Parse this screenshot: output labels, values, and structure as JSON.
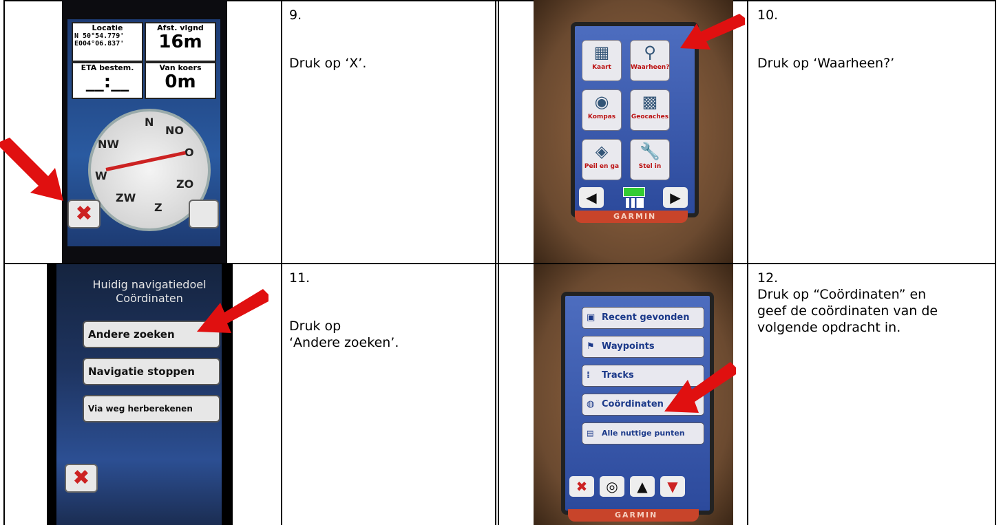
{
  "steps": [
    {
      "number": "9.",
      "instruction": "Druk op ‘X’."
    },
    {
      "number": "10.",
      "instruction": "Druk op ‘Waarheen?’"
    },
    {
      "number": "11.",
      "instruction": "Druk op\n‘Andere zoeken’."
    },
    {
      "number": "12.",
      "instruction": "Druk op “Coördinaten” en\ngeef de coördinaten van de\nvolgende opdracht in."
    }
  ],
  "photo1": {
    "locatie_label": "Locatie",
    "coord_n": "N 50°54.779'",
    "coord_e": "E004°06.837'",
    "afst_label": "Afst. vlgnd",
    "afst_value": "16m",
    "eta_label": "ETA bestem.",
    "eta_value": "__:__",
    "koers_label": "Van koers",
    "koers_value": "0m",
    "compass": [
      "N",
      "NO",
      "O",
      "ZO",
      "Z",
      "ZW",
      "W",
      "NW"
    ]
  },
  "photo2": {
    "tiles": [
      "Kaart",
      "Waarheen?",
      "Kompas",
      "Geocaches",
      "Peil en ga",
      "Stel in"
    ],
    "brand": "GARMIN"
  },
  "photo3": {
    "title_line1": "Huidig navigatiedoel",
    "title_line2": "Coördinaten",
    "buttons": [
      "Andere zoeken",
      "Navigatie stoppen",
      "Via weg herberekenen"
    ]
  },
  "photo4": {
    "items": [
      "Recent gevonden",
      "Waypoints",
      "Tracks",
      "Coördinaten",
      "Alle nuttige punten"
    ],
    "brand": "GARMIN"
  }
}
